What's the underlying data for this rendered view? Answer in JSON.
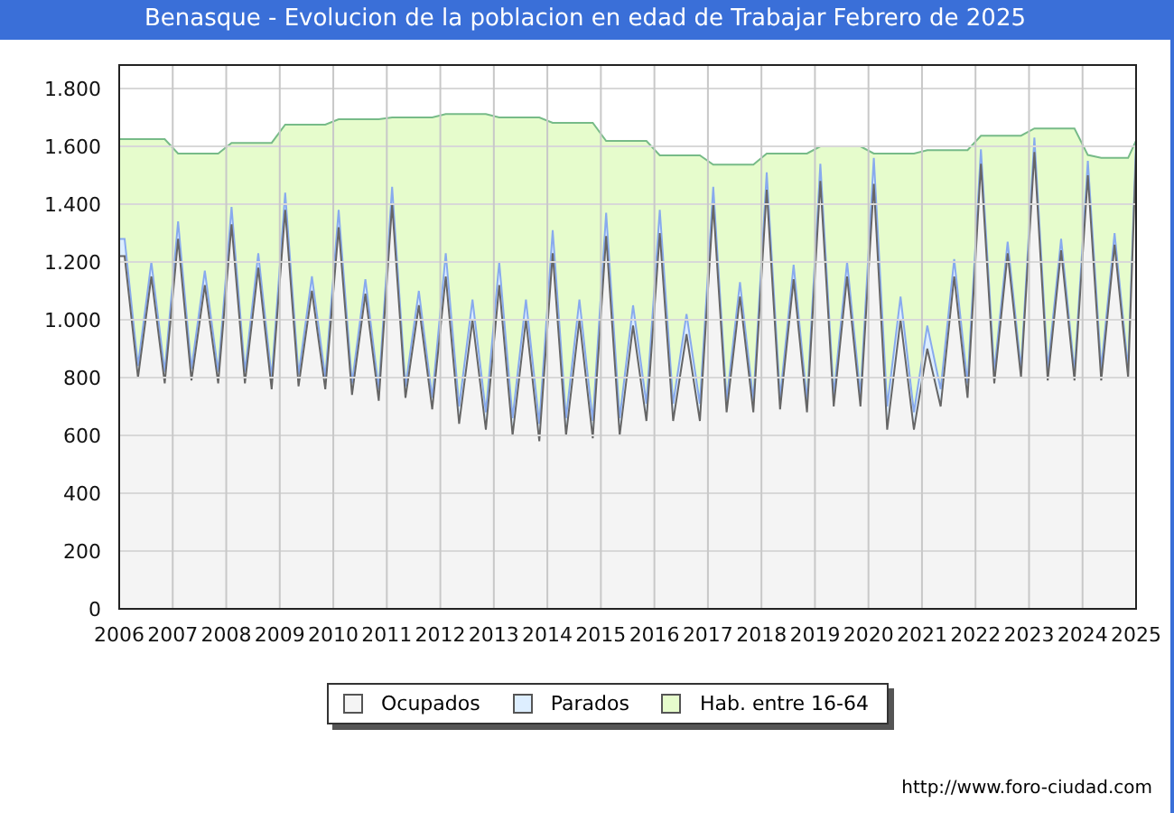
{
  "title": "Benasque - Evolucion de la poblacion en edad de Trabajar Febrero de 2025",
  "chart_data": {
    "type": "area",
    "x": [
      2006.1,
      2006.35,
      2006.6,
      2006.85,
      2007.1,
      2007.35,
      2007.6,
      2007.85,
      2008.1,
      2008.35,
      2008.6,
      2008.85,
      2009.1,
      2009.35,
      2009.6,
      2009.85,
      2010.1,
      2010.35,
      2010.6,
      2010.85,
      2011.1,
      2011.35,
      2011.6,
      2011.85,
      2012.1,
      2012.35,
      2012.6,
      2012.85,
      2013.1,
      2013.35,
      2013.6,
      2013.85,
      2014.1,
      2014.35,
      2014.6,
      2014.85,
      2015.1,
      2015.35,
      2015.6,
      2015.85,
      2016.1,
      2016.35,
      2016.6,
      2016.85,
      2017.1,
      2017.35,
      2017.6,
      2017.85,
      2018.1,
      2018.35,
      2018.6,
      2018.85,
      2019.1,
      2019.35,
      2019.6,
      2019.85,
      2020.1,
      2020.35,
      2020.6,
      2020.85,
      2021.1,
      2021.35,
      2021.6,
      2021.85,
      2022.1,
      2022.35,
      2022.6,
      2022.85,
      2023.1,
      2023.35,
      2023.6,
      2023.85,
      2024.1,
      2024.35,
      2024.6,
      2024.85,
      2025.0
    ],
    "stacked": true,
    "grid": true,
    "series": [
      {
        "name": "Ocupados",
        "color": "#f4f4f4",
        "values": [
          1220,
          800,
          1150,
          780,
          1280,
          790,
          1120,
          780,
          1330,
          780,
          1180,
          760,
          1380,
          770,
          1100,
          760,
          1320,
          740,
          1090,
          720,
          1400,
          730,
          1050,
          690,
          1150,
          640,
          1000,
          620,
          1120,
          600,
          1000,
          580,
          1230,
          600,
          1000,
          590,
          1290,
          600,
          980,
          650,
          1300,
          650,
          950,
          650,
          1400,
          680,
          1080,
          680,
          1450,
          690,
          1140,
          680,
          1480,
          700,
          1150,
          700,
          1470,
          620,
          1000,
          620,
          900,
          700,
          1150,
          730,
          1540,
          780,
          1230,
          800,
          1580,
          790,
          1240,
          790,
          1500,
          790,
          1260,
          800,
          1580
        ]
      },
      {
        "name": "Parados",
        "color": "#ddeeff",
        "values": [
          60,
          40,
          50,
          40,
          60,
          40,
          50,
          40,
          60,
          40,
          50,
          40,
          60,
          40,
          50,
          40,
          60,
          40,
          50,
          40,
          60,
          40,
          50,
          40,
          80,
          60,
          70,
          60,
          80,
          60,
          70,
          60,
          80,
          60,
          70,
          60,
          80,
          60,
          70,
          60,
          80,
          60,
          70,
          60,
          60,
          40,
          50,
          40,
          60,
          40,
          50,
          40,
          60,
          40,
          50,
          40,
          90,
          80,
          80,
          60,
          80,
          60,
          60,
          50,
          50,
          40,
          40,
          30,
          50,
          40,
          40,
          30,
          50,
          40,
          40,
          30,
          40
        ]
      },
      {
        "name": "Hab. entre 16-64",
        "color": "#e6fccc",
        "values": [
          345,
          785,
          425,
          805,
          235,
          745,
          405,
          755,
          222,
          792,
          382,
          812,
          235,
          865,
          525,
          875,
          314,
          914,
          554,
          934,
          240,
          930,
          600,
          970,
          482,
          1012,
          642,
          1032,
          500,
          1040,
          630,
          1060,
          371,
          1021,
          611,
          1031,
          249,
          959,
          569,
          909,
          189,
          859,
          549,
          859,
          77,
          817,
          407,
          817,
          65,
          845,
          385,
          855,
          60,
          860,
          400,
          860,
          15,
          875,
          495,
          895,
          607,
          827,
          377,
          807,
          47,
          817,
          367,
          807,
          32,
          832,
          382,
          842,
          20,
          730,
          260,
          730,
          0
        ]
      }
    ],
    "xlim": [
      2006,
      2025
    ],
    "ylim": [
      0,
      1800
    ],
    "xticks": [
      2006,
      2007,
      2008,
      2009,
      2010,
      2011,
      2012,
      2013,
      2014,
      2015,
      2016,
      2017,
      2018,
      2019,
      2020,
      2021,
      2022,
      2023,
      2024,
      2025
    ],
    "yticks": [
      {
        "value": 0,
        "label": "0"
      },
      {
        "value": 200,
        "label": "200"
      },
      {
        "value": 400,
        "label": "400"
      },
      {
        "value": 600,
        "label": "600"
      },
      {
        "value": 800,
        "label": "800"
      },
      {
        "value": 1000,
        "label": "1.000"
      },
      {
        "value": 1200,
        "label": "1.200"
      },
      {
        "value": 1400,
        "label": "1.400"
      },
      {
        "value": 1600,
        "label": "1.600"
      },
      {
        "value": 1800,
        "label": "1.800"
      }
    ]
  },
  "source": "http://www.foro-ciudad.com"
}
